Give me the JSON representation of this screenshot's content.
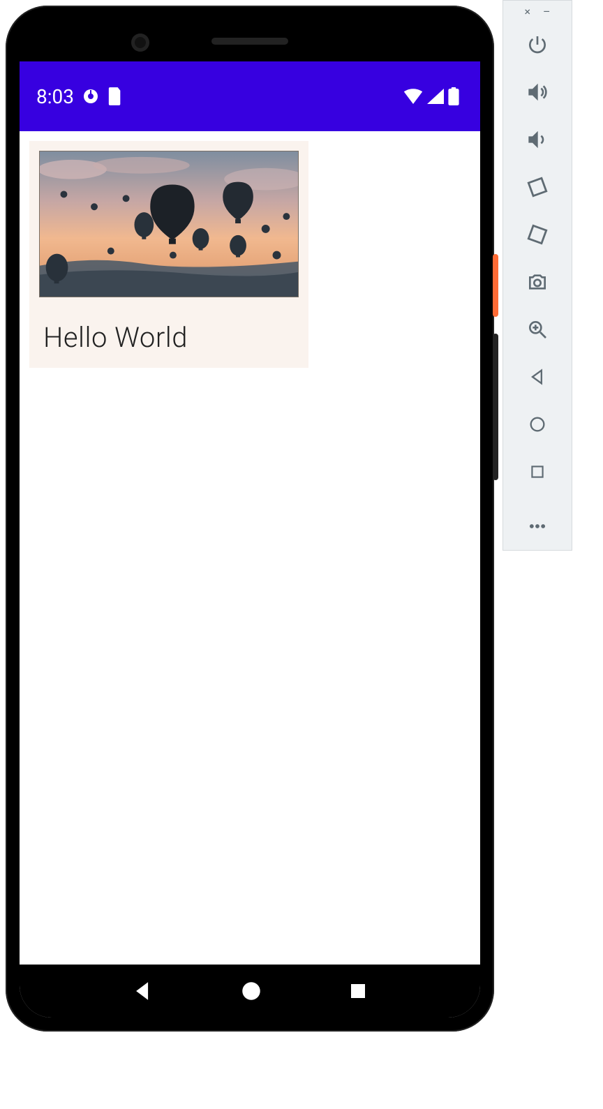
{
  "statusbar": {
    "time": "8:03",
    "icons_left": [
      "clock-icon",
      "sim-icon"
    ],
    "icons_right": [
      "wifi-icon",
      "signal-icon",
      "battery-icon"
    ]
  },
  "app": {
    "card": {
      "image_alt": "hot-air-balloons-sunset",
      "text": "Hello World"
    }
  },
  "navbar": {
    "back": "back",
    "home": "home",
    "recents": "recents"
  },
  "emulator_toolbar": {
    "window_close": "×",
    "window_minimize": "–",
    "buttons": [
      {
        "name": "power-icon"
      },
      {
        "name": "volume-up-icon"
      },
      {
        "name": "volume-down-icon"
      },
      {
        "name": "rotate-left-icon"
      },
      {
        "name": "rotate-right-icon"
      },
      {
        "name": "camera-icon"
      },
      {
        "name": "zoom-icon"
      },
      {
        "name": "back-icon"
      },
      {
        "name": "home-icon"
      },
      {
        "name": "overview-icon"
      },
      {
        "name": "more-icon"
      }
    ]
  }
}
